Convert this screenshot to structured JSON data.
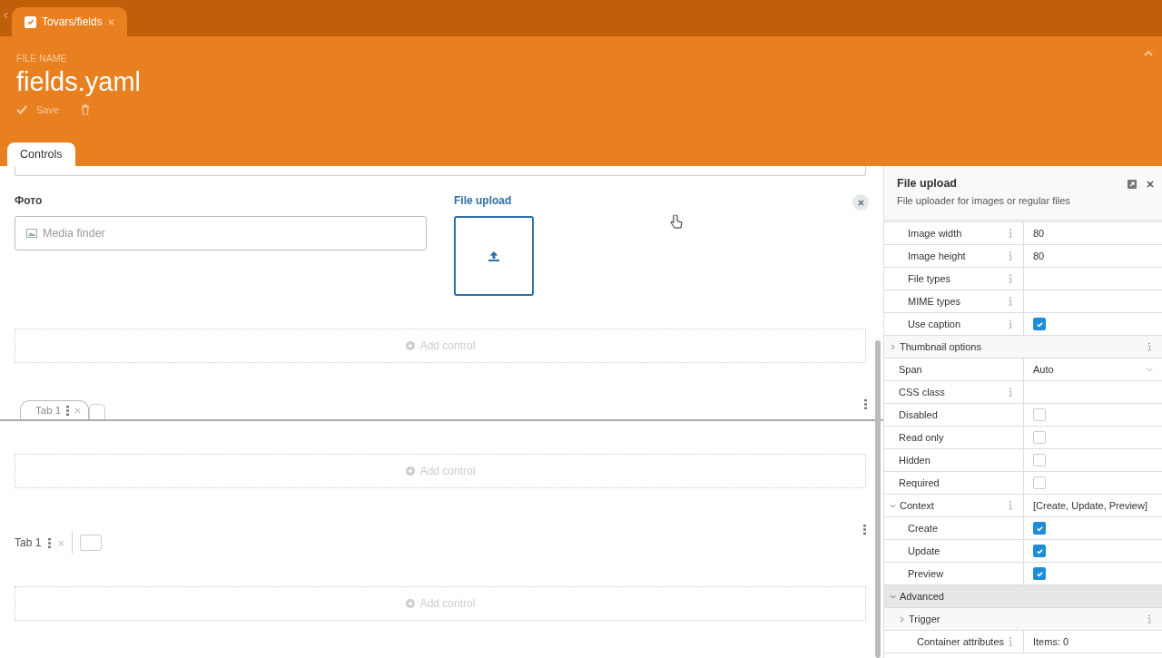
{
  "file_tab": {
    "label": "Tovars/fields",
    "checked": true
  },
  "header": {
    "caption": "FILE NAME",
    "file_name": "fields.yaml",
    "save_label": "Save"
  },
  "tabs": [
    {
      "label": "Controls",
      "selected": true
    }
  ],
  "canvas": {
    "fields": [
      {
        "label": "Фото",
        "kind": "media",
        "placeholder": "Media finder",
        "selected": false
      },
      {
        "label": "File upload",
        "kind": "upload",
        "selected": true
      }
    ],
    "add_control": "Add control",
    "tab_sets": [
      {
        "kind": "tabs",
        "tabs": [
          {
            "label": "Tab 1"
          }
        ],
        "add_control": "Add control"
      },
      {
        "kind": "pills",
        "tabs": [
          {
            "label": "Tab 1"
          }
        ],
        "add_control": "Add control"
      }
    ]
  },
  "inspector": {
    "title": "File upload",
    "description": "File uploader for images or regular files",
    "rows": [
      {
        "kind": "field",
        "label": "Image width",
        "info": true,
        "value": "80",
        "indented": true
      },
      {
        "kind": "field",
        "label": "Image height",
        "info": true,
        "value": "80",
        "indented": true
      },
      {
        "kind": "field",
        "label": "File types",
        "info": true,
        "indented": true
      },
      {
        "kind": "field",
        "label": "MIME types",
        "info": true,
        "indented": true
      },
      {
        "kind": "checkbox",
        "label": "Use caption",
        "info": true,
        "checked": true,
        "indented": true
      },
      {
        "kind": "group",
        "label": "Thumbnail options",
        "info": true,
        "expanded": false
      },
      {
        "kind": "select",
        "label": "Span",
        "value": "Auto"
      },
      {
        "kind": "field",
        "label": "CSS class",
        "info": true
      },
      {
        "kind": "checkbox",
        "label": "Disabled",
        "info": false,
        "checked": false
      },
      {
        "kind": "checkbox",
        "label": "Read only",
        "info": false,
        "checked": false
      },
      {
        "kind": "checkbox",
        "label": "Hidden",
        "info": false,
        "checked": false
      },
      {
        "kind": "checkbox",
        "label": "Required",
        "info": false,
        "checked": false
      },
      {
        "kind": "group",
        "label": "Context",
        "info": true,
        "expanded": true,
        "value": "[Create, Update, Preview]",
        "children": [
          {
            "kind": "checkbox",
            "label": "Create",
            "info": false,
            "checked": true
          },
          {
            "kind": "checkbox",
            "label": "Update",
            "info": false,
            "checked": true
          },
          {
            "kind": "checkbox",
            "label": "Preview",
            "info": false,
            "checked": true
          }
        ]
      },
      {
        "kind": "section",
        "label": "Advanced",
        "expanded": true,
        "children": [
          {
            "kind": "group",
            "label": "Trigger",
            "info": true,
            "expanded": false
          },
          {
            "kind": "field",
            "label": "Container attributes",
            "info": true,
            "value": "Items: 0",
            "indented": true
          }
        ]
      }
    ]
  }
}
